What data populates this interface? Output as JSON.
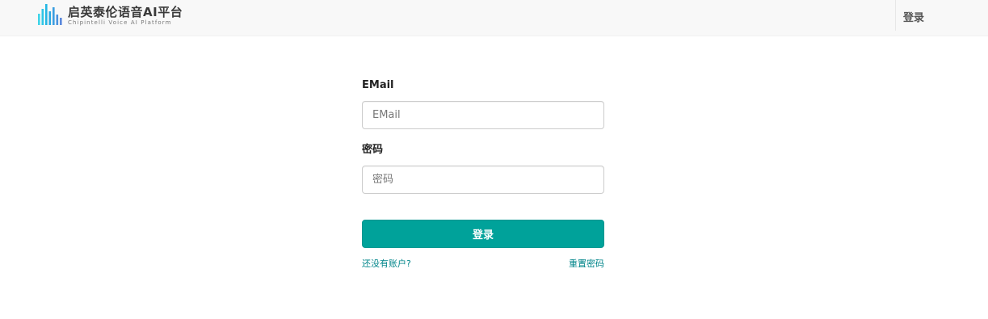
{
  "header": {
    "brand_cn": "启英泰伦语音AI平台",
    "brand_en": "Chipintelli Voice AI Platform",
    "login_link": "登录",
    "logo_icon": "sound-bars-icon",
    "brand_colors": [
      "#1ec8e6",
      "#2aa3e0"
    ]
  },
  "form": {
    "email_label": "EMail",
    "email_placeholder": "EMail",
    "email_value": "",
    "password_label": "密码",
    "password_placeholder": "密码",
    "password_value": "",
    "submit_label": "登录",
    "submit_color": "#00a29a",
    "register_link": "还没有账户?",
    "reset_link": "重置密码",
    "link_color": "#00858a"
  }
}
